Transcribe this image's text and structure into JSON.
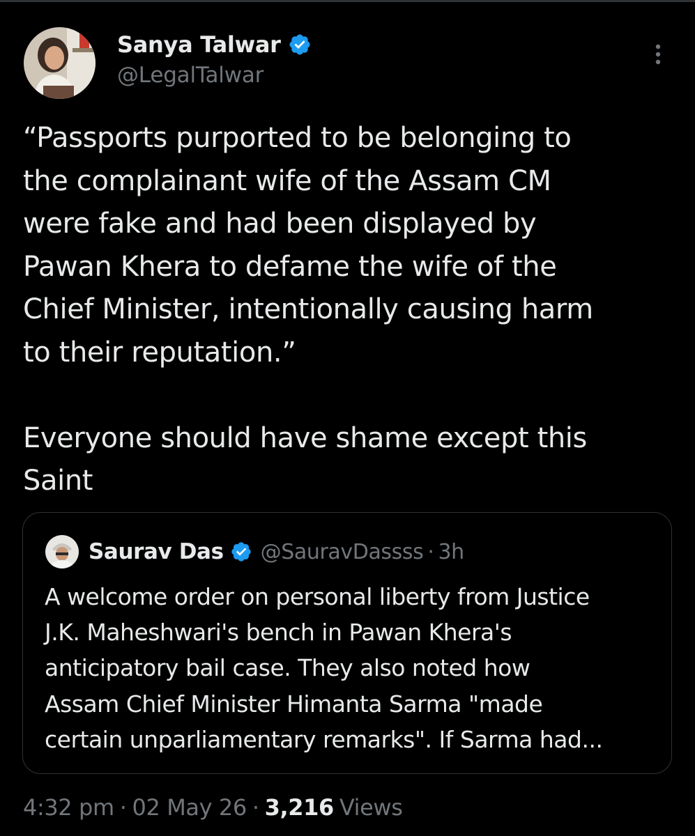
{
  "tweet": {
    "author": {
      "name": "Sanya Talwar",
      "handle": "@LegalTalwar",
      "verified": true,
      "avatar": "profile-photo-avatar"
    },
    "text_lines": [
      "“Passports purported to be belonging to",
      "the complainant wife of the Assam CM",
      "were fake and had been displayed by",
      "Pawan Khera to defame the wife of the",
      "Chief Minister, intentionally causing harm",
      "to their reputation.”",
      "",
      "Everyone should have shame except this",
      "Saint"
    ],
    "more_icon": "more-options-icon",
    "quoted": {
      "author_name": "Saurav Das",
      "handle": "@SauravDassss",
      "separator": "·",
      "time": "3h",
      "verified": true,
      "avatar": "profile-photo-avatar",
      "text_lines": [
        "A welcome order on personal liberty from Justice",
        "J.K. Maheshwari's bench in Pawan Khera's",
        "anticipatory bail case. They also noted how",
        "Assam Chief Minister Himanta Sarma \"made",
        "certain unparliamentary remarks\". If Sarma had..."
      ]
    },
    "meta": {
      "time": "4:32 pm",
      "separator": "·",
      "date": "02 May 26",
      "views_count": "3,216",
      "views_label": "Views"
    }
  },
  "colors": {
    "background": "#000000",
    "text_primary": "#e7e9ea",
    "text_secondary": "#71767b",
    "border": "#2f3336",
    "verified_badge": "#1d9bf0"
  }
}
